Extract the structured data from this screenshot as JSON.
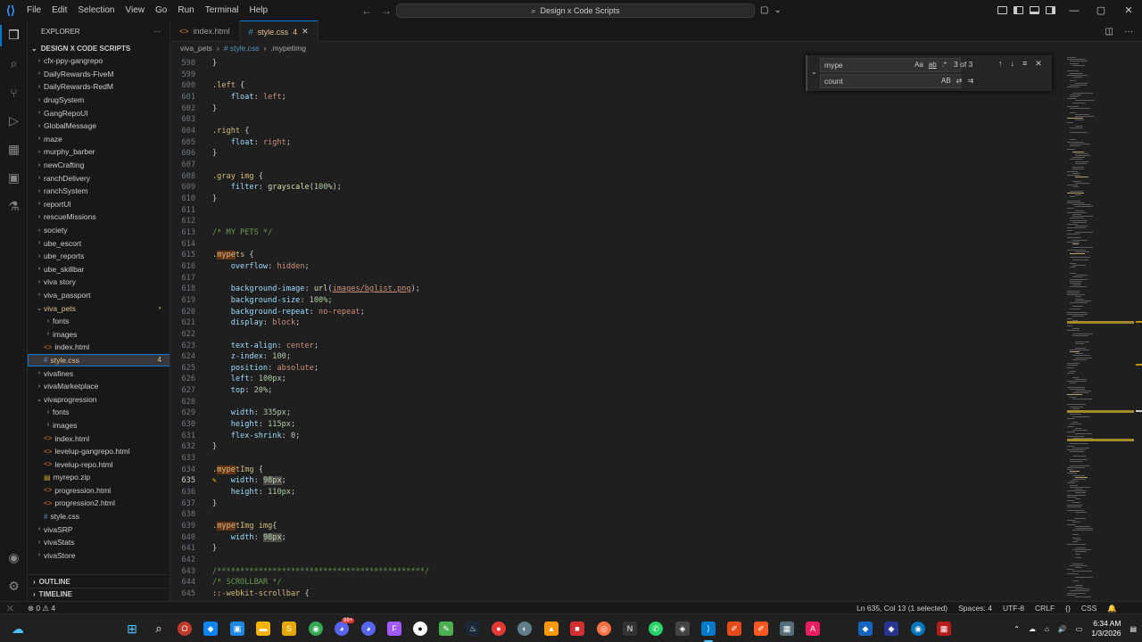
{
  "window": {
    "menu": [
      "File",
      "Edit",
      "Selection",
      "View",
      "Go",
      "Run",
      "Terminal",
      "Help"
    ],
    "search": "Design x Code Scripts"
  },
  "explorer": {
    "title": "EXPLORER",
    "workspace": "DESIGN X CODE SCRIPTS",
    "items": [
      {
        "label": "cfx-ppy-gangrepo",
        "type": "folder",
        "open": false,
        "depth": 1
      },
      {
        "label": "DailyRewards-FiveM",
        "type": "folder",
        "open": false,
        "depth": 1
      },
      {
        "label": "DailyRewards-RedM",
        "type": "folder",
        "open": false,
        "depth": 1
      },
      {
        "label": "drugSystem",
        "type": "folder",
        "open": false,
        "depth": 1
      },
      {
        "label": "GangRepoUI",
        "type": "folder",
        "open": false,
        "depth": 1
      },
      {
        "label": "GlobalMessage",
        "type": "folder",
        "open": false,
        "depth": 1
      },
      {
        "label": "maze",
        "type": "folder",
        "open": false,
        "depth": 1
      },
      {
        "label": "murphy_barber",
        "type": "folder",
        "open": false,
        "depth": 1
      },
      {
        "label": "newCrafting",
        "type": "folder",
        "open": false,
        "depth": 1
      },
      {
        "label": "ranchDelivery",
        "type": "folder",
        "open": false,
        "depth": 1
      },
      {
        "label": "ranchSystem",
        "type": "folder",
        "open": false,
        "depth": 1
      },
      {
        "label": "reportUI",
        "type": "folder",
        "open": false,
        "depth": 1
      },
      {
        "label": "rescueMissions",
        "type": "folder",
        "open": false,
        "depth": 1
      },
      {
        "label": "society",
        "type": "folder",
        "open": false,
        "depth": 1
      },
      {
        "label": "ube_escort",
        "type": "folder",
        "open": false,
        "depth": 1
      },
      {
        "label": "ube_reports",
        "type": "folder",
        "open": false,
        "depth": 1
      },
      {
        "label": "ube_skillbar",
        "type": "folder",
        "open": false,
        "depth": 1
      },
      {
        "label": "viva story",
        "type": "folder",
        "open": false,
        "depth": 1
      },
      {
        "label": "viva_passport",
        "type": "folder",
        "open": false,
        "depth": 1
      },
      {
        "label": "viva_pets",
        "type": "folder",
        "open": true,
        "depth": 1,
        "color": "#e2c08d",
        "dot": true
      },
      {
        "label": "fonts",
        "type": "folder",
        "open": false,
        "depth": 2
      },
      {
        "label": "images",
        "type": "folder",
        "open": false,
        "depth": 2
      },
      {
        "label": "index.html",
        "type": "html",
        "depth": 2
      },
      {
        "label": "style.css",
        "type": "css",
        "depth": 2,
        "selected": true,
        "color": "#e2c08d",
        "badge": "4"
      },
      {
        "label": "vivafines",
        "type": "folder",
        "open": false,
        "depth": 1
      },
      {
        "label": "vivaMarketplace",
        "type": "folder",
        "open": false,
        "depth": 1
      },
      {
        "label": "vivaprogression",
        "type": "folder",
        "open": true,
        "depth": 1
      },
      {
        "label": "fonts",
        "type": "folder",
        "open": false,
        "depth": 2
      },
      {
        "label": "images",
        "type": "folder",
        "open": false,
        "depth": 2
      },
      {
        "label": "index.html",
        "type": "html",
        "depth": 2
      },
      {
        "label": "levelup-gangrepo.html",
        "type": "html",
        "depth": 2
      },
      {
        "label": "levelup-repo.html",
        "type": "html",
        "depth": 2
      },
      {
        "label": "myrepo.zip",
        "type": "zip",
        "depth": 2
      },
      {
        "label": "progression.html",
        "type": "html",
        "depth": 2
      },
      {
        "label": "progression2.html",
        "type": "html",
        "depth": 2
      },
      {
        "label": "style.css",
        "type": "css",
        "depth": 2
      },
      {
        "label": "vivaSRP",
        "type": "folder",
        "open": false,
        "depth": 1
      },
      {
        "label": "vivaStats",
        "type": "folder",
        "open": false,
        "depth": 1
      },
      {
        "label": "vivaStore",
        "type": "folder",
        "open": false,
        "depth": 1
      }
    ],
    "outline": "OUTLINE",
    "timeline": "TIMELINE"
  },
  "tabs": [
    {
      "label": "index.html",
      "icon": "html",
      "active": false
    },
    {
      "label": "style.css",
      "icon": "css",
      "active": true,
      "badge": "4"
    }
  ],
  "breadcrumb": [
    "viva_pets",
    "# style.css",
    ".mypetImg"
  ],
  "find": {
    "query": "mype",
    "result": "3 of 3",
    "replace": "count",
    "options": [
      "Aa",
      "ab",
      ".*"
    ],
    "replace_options": [
      "AB"
    ]
  },
  "editor": {
    "lines": [
      {
        "n": "598",
        "code": "}"
      },
      {
        "n": "599",
        "code": ""
      },
      {
        "n": "600",
        "code": ".left {"
      },
      {
        "n": "601",
        "code": "    float: left;"
      },
      {
        "n": "602",
        "code": "}"
      },
      {
        "n": "603",
        "code": ""
      },
      {
        "n": "604",
        "code": ".right {"
      },
      {
        "n": "605",
        "code": "    float: right;"
      },
      {
        "n": "606",
        "code": "}"
      },
      {
        "n": "607",
        "code": ""
      },
      {
        "n": "608",
        "code": ".gray img {"
      },
      {
        "n": "609",
        "code": "    filter: grayscale(100%);"
      },
      {
        "n": "610",
        "code": "}"
      },
      {
        "n": "611",
        "code": ""
      },
      {
        "n": "612",
        "code": ""
      },
      {
        "n": "613",
        "code": "/* MY PETS */"
      },
      {
        "n": "614",
        "code": ""
      },
      {
        "n": "615",
        "code": ".mypets {"
      },
      {
        "n": "616",
        "code": "    overflow: hidden;"
      },
      {
        "n": "617",
        "code": ""
      },
      {
        "n": "618",
        "code": "    background-image: url(images/bglist.png);"
      },
      {
        "n": "619",
        "code": "    background-size: 100%;"
      },
      {
        "n": "620",
        "code": "    background-repeat: no-repeat;"
      },
      {
        "n": "621",
        "code": "    display: block;"
      },
      {
        "n": "622",
        "code": ""
      },
      {
        "n": "623",
        "code": "    text-align: center;"
      },
      {
        "n": "624",
        "code": "    z-index: 100;"
      },
      {
        "n": "625",
        "code": "    position: absolute;"
      },
      {
        "n": "626",
        "code": "    left: 100px;"
      },
      {
        "n": "627",
        "code": "    top: 20%;"
      },
      {
        "n": "628",
        "code": ""
      },
      {
        "n": "629",
        "code": "    width: 335px;"
      },
      {
        "n": "630",
        "code": "    height: 115px;"
      },
      {
        "n": "631",
        "code": "    flex-shrink: 0;"
      },
      {
        "n": "632",
        "code": "}"
      },
      {
        "n": "633",
        "code": ""
      },
      {
        "n": "634",
        "code": ".mypetImg {"
      },
      {
        "n": "635",
        "code": "    width: 98px;"
      },
      {
        "n": "636",
        "code": "    height: 110px;"
      },
      {
        "n": "637",
        "code": "}"
      },
      {
        "n": "638",
        "code": ""
      },
      {
        "n": "639",
        "code": ".mypetImg img{"
      },
      {
        "n": "640",
        "code": "    width: 98px;"
      },
      {
        "n": "641",
        "code": "}"
      },
      {
        "n": "642",
        "code": ""
      },
      {
        "n": "643",
        "code": "/*********************************************/"
      },
      {
        "n": "644",
        "code": "/* SCROLLBAR */"
      },
      {
        "n": "645",
        "code": "::-webkit-scrollbar {"
      }
    ],
    "current_line": "635"
  },
  "status": {
    "errors": "0",
    "warnings": "4",
    "position": "Ln 635, Col 13 (1 selected)",
    "spaces": "Spaces: 4",
    "encoding": "UTF-8",
    "eol": "CRLF",
    "braces": "{}",
    "language": "CSS"
  },
  "taskbar": {
    "time": "6:34 AM",
    "date": "1/3/2026",
    "badges": {
      "discord": "99+"
    }
  },
  "colors": {
    "accent": "#0078d4",
    "modified": "#e2c08d",
    "selector": "#d7ba7d",
    "property": "#9cdcfe",
    "value": "#ce9178",
    "number": "#b5cea8",
    "comment": "#6a9955"
  }
}
